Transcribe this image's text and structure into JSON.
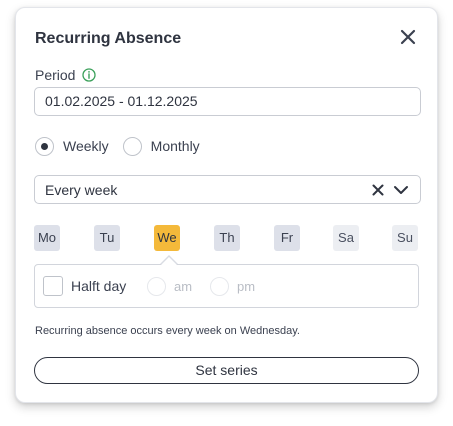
{
  "dialog": {
    "title": "Recurring Absence"
  },
  "period": {
    "label": "Period",
    "value": "01.02.2025 - 01.12.2025"
  },
  "frequency": {
    "options": [
      {
        "label": "Weekly",
        "checked": true
      },
      {
        "label": "Monthly",
        "checked": false
      }
    ]
  },
  "interval": {
    "selected": "Every week"
  },
  "days": [
    {
      "label": "Mo",
      "state": "weekday"
    },
    {
      "label": "Tu",
      "state": "weekday"
    },
    {
      "label": "We",
      "state": "active"
    },
    {
      "label": "Th",
      "state": "weekday"
    },
    {
      "label": "Fr",
      "state": "weekday"
    },
    {
      "label": "Sa",
      "state": "weekend"
    },
    {
      "label": "Su",
      "state": "weekend"
    }
  ],
  "half_day": {
    "label": "Halft day",
    "am_label": "am",
    "pm_label": "pm"
  },
  "summary": "Recurring absence occurs every week on Wednesday.",
  "actions": {
    "submit_label": "Set series"
  },
  "colors": {
    "accent_active_day": "#f4b93a",
    "info_icon": "#3aa05a",
    "text": "#2f3440"
  }
}
